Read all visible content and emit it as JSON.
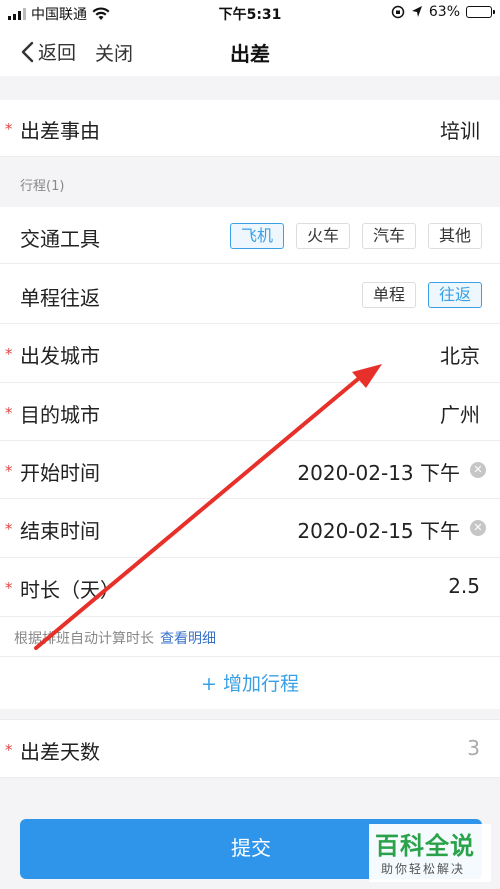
{
  "status_bar": {
    "carrier": "中国联通",
    "time": "下午5:31",
    "battery": "63%",
    "battery_level": 0.63
  },
  "nav": {
    "back_label": "返回",
    "close_label": "关闭",
    "title": "出差"
  },
  "form": {
    "reason": {
      "label": "出差事由",
      "value": "培训"
    },
    "trip_section": "行程(1)",
    "transport": {
      "label": "交通工具",
      "options": [
        "飞机",
        "火车",
        "汽车",
        "其他"
      ],
      "selected": "飞机"
    },
    "trip_type": {
      "label": "单程往返",
      "options": [
        "单程",
        "往返"
      ],
      "selected": "往返"
    },
    "depart_city": {
      "label": "出发城市",
      "value": "北京"
    },
    "dest_city": {
      "label": "目的城市",
      "value": "广州"
    },
    "start_time": {
      "label": "开始时间",
      "value": "2020-02-13 下午"
    },
    "end_time": {
      "label": "结束时间",
      "value": "2020-02-15 下午"
    },
    "duration": {
      "label": "时长（天）",
      "value": "2.5"
    },
    "hint_text": "根据排班自动计算时长",
    "hint_link": "查看明细",
    "add_trip": "+ 增加行程",
    "trip_days": {
      "label": "出差天数",
      "value": "3"
    }
  },
  "submit_label": "提交",
  "watermark": {
    "main": "百科全说",
    "sub": "助你轻松解决"
  },
  "colors": {
    "accent": "#2f95ea",
    "required": "#e04545",
    "arrow": "#e8302a"
  },
  "icons": [
    "signal-icon",
    "wifi-icon",
    "battery-icon",
    "back-chevron-icon",
    "clear-icon",
    "annotation-arrow-icon"
  ]
}
